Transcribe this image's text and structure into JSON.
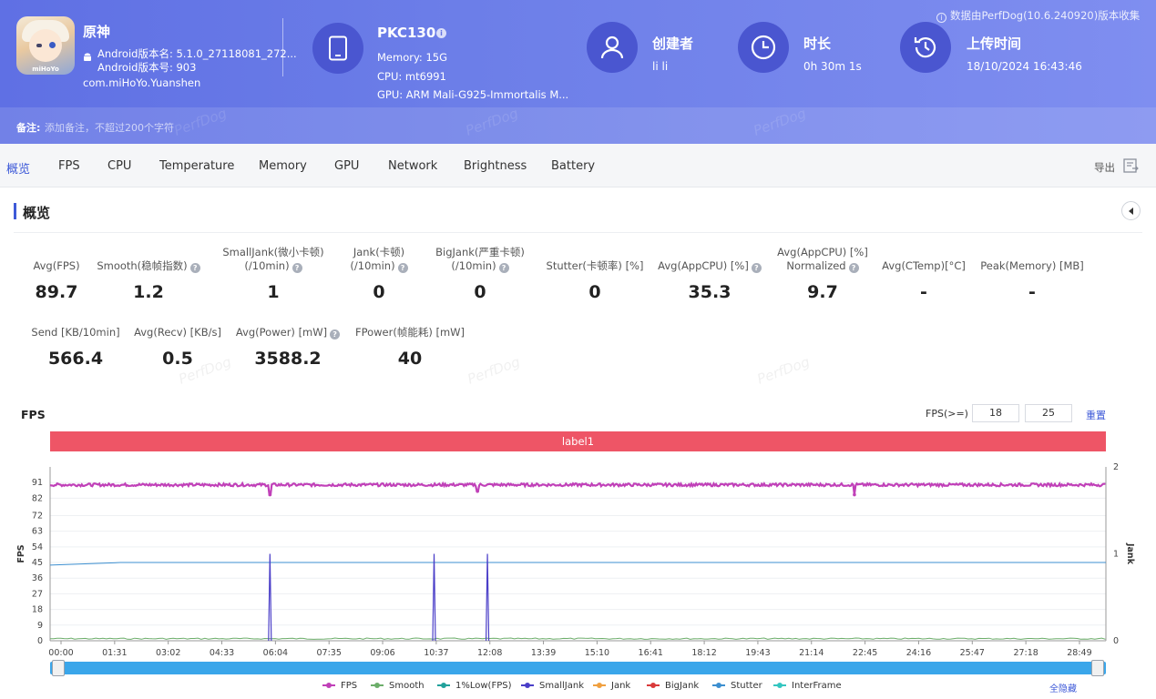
{
  "header": {
    "app_name": "原神",
    "android_version_name": "Android版本名: 5.1.0_27118081_272...",
    "android_version_code": "Android版本号: 903",
    "package_name": "com.miHoYo.Yuanshen",
    "app_icon_brand": "miHoYo",
    "device_model": "PKC130",
    "memory": "Memory: 15G",
    "cpu": "CPU: mt6991",
    "gpu": "GPU: ARM Mali-G925-Immortalis M...",
    "creator_title": "创建者",
    "creator_value": "li li",
    "duration_title": "时长",
    "duration_value": "0h 30m 1s",
    "upload_title": "上传时间",
    "upload_value": "18/10/2024 16:43:46",
    "collect_note": "数据由PerfDog(10.6.240920)版本收集",
    "remark_label": "备注:",
    "remark_placeholder": "添加备注，不超过200个字符",
    "accent_color": "#4a56d0"
  },
  "tabs": [
    "概览",
    "FPS",
    "CPU",
    "Temperature",
    "Memory",
    "GPU",
    "Network",
    "Brightness",
    "Battery"
  ],
  "active_tab": "概览",
  "export_label": "导出",
  "overview": {
    "title": "概览",
    "stats_row1": [
      {
        "label": [
          "Avg(FPS)"
        ],
        "value": "89.7",
        "help": false
      },
      {
        "label": [
          "Smooth(稳帧指数)"
        ],
        "value": "1.2",
        "help": true
      },
      {
        "label": [
          "SmallJank(微小卡顿)",
          "(/10min)"
        ],
        "value": "1",
        "help": true
      },
      {
        "label": [
          "Jank(卡顿)",
          "(/10min)"
        ],
        "value": "0",
        "help": true
      },
      {
        "label": [
          "BigJank(严重卡顿)",
          "(/10min)"
        ],
        "value": "0",
        "help": true
      },
      {
        "label": [
          "Stutter(卡顿率) [%]"
        ],
        "value": "0",
        "help": false
      },
      {
        "label": [
          "Avg(AppCPU) [%]"
        ],
        "value": "35.3",
        "help": true
      },
      {
        "label": [
          "Avg(AppCPU) [%]",
          "Normalized"
        ],
        "value": "9.7",
        "help": true
      },
      {
        "label": [
          "Avg(CTemp)[°C]"
        ],
        "value": "-",
        "help": false
      },
      {
        "label": [
          "Peak(Memory) [MB]"
        ],
        "value": "-",
        "help": false
      }
    ],
    "stats_row2": [
      {
        "label": [
          "Send [KB/10min]"
        ],
        "value": "566.4",
        "help": false
      },
      {
        "label": [
          "Avg(Recv) [KB/s]"
        ],
        "value": "0.5",
        "help": false
      },
      {
        "label": [
          "Avg(Power) [mW]"
        ],
        "value": "3588.2",
        "help": true
      },
      {
        "label": [
          "FPower(帧能耗) [mW]"
        ],
        "value": "40",
        "help": false
      }
    ]
  },
  "chart_section": {
    "title": "FPS",
    "threshold_label": "FPS(>=)",
    "threshold_1": "18",
    "threshold_2": "25",
    "reset_label": "重置",
    "band_label": "label1",
    "hide_all_label": "全隐藏",
    "watermark": "PerfDog"
  },
  "chart_data": {
    "type": "line",
    "ylabel": "FPS",
    "y2label": "Jank",
    "ylim": [
      0,
      100
    ],
    "y2lim": [
      0,
      2
    ],
    "y_ticks": [
      0,
      9,
      18,
      27,
      36,
      45,
      54,
      63,
      72,
      82,
      91
    ],
    "y2_ticks": [
      0,
      1,
      2
    ],
    "x_ticks": [
      "00:00",
      "01:31",
      "03:02",
      "04:33",
      "06:04",
      "07:35",
      "09:06",
      "10:37",
      "12:08",
      "13:39",
      "15:10",
      "16:41",
      "18:12",
      "19:43",
      "21:14",
      "22:45",
      "24:16",
      "25:47",
      "27:18",
      "28:49"
    ],
    "x_range_seconds": [
      0,
      1801
    ],
    "series": [
      {
        "name": "FPS",
        "color": "#c040b8",
        "typical": 89.7,
        "dips": [
          {
            "t": 375,
            "v": 84
          },
          {
            "t": 729,
            "v": 86
          },
          {
            "t": 1372,
            "v": 84
          }
        ]
      },
      {
        "name": "Smooth",
        "color": "#6cae6a",
        "typical": 1.2
      },
      {
        "name": "1%Low(FPS)",
        "color": "#21a19b"
      },
      {
        "name": "SmallJank",
        "color": "#4a3ec8",
        "events": [
          375,
          655,
          746
        ]
      },
      {
        "name": "Jank",
        "color": "#f0a040"
      },
      {
        "name": "BigJank",
        "color": "#d93a3a"
      },
      {
        "name": "Stutter",
        "color": "#3c8fd0",
        "typical": 45
      },
      {
        "name": "InterFrame",
        "color": "#34c6c0"
      }
    ],
    "legend_position": "bottom",
    "grid": true
  }
}
